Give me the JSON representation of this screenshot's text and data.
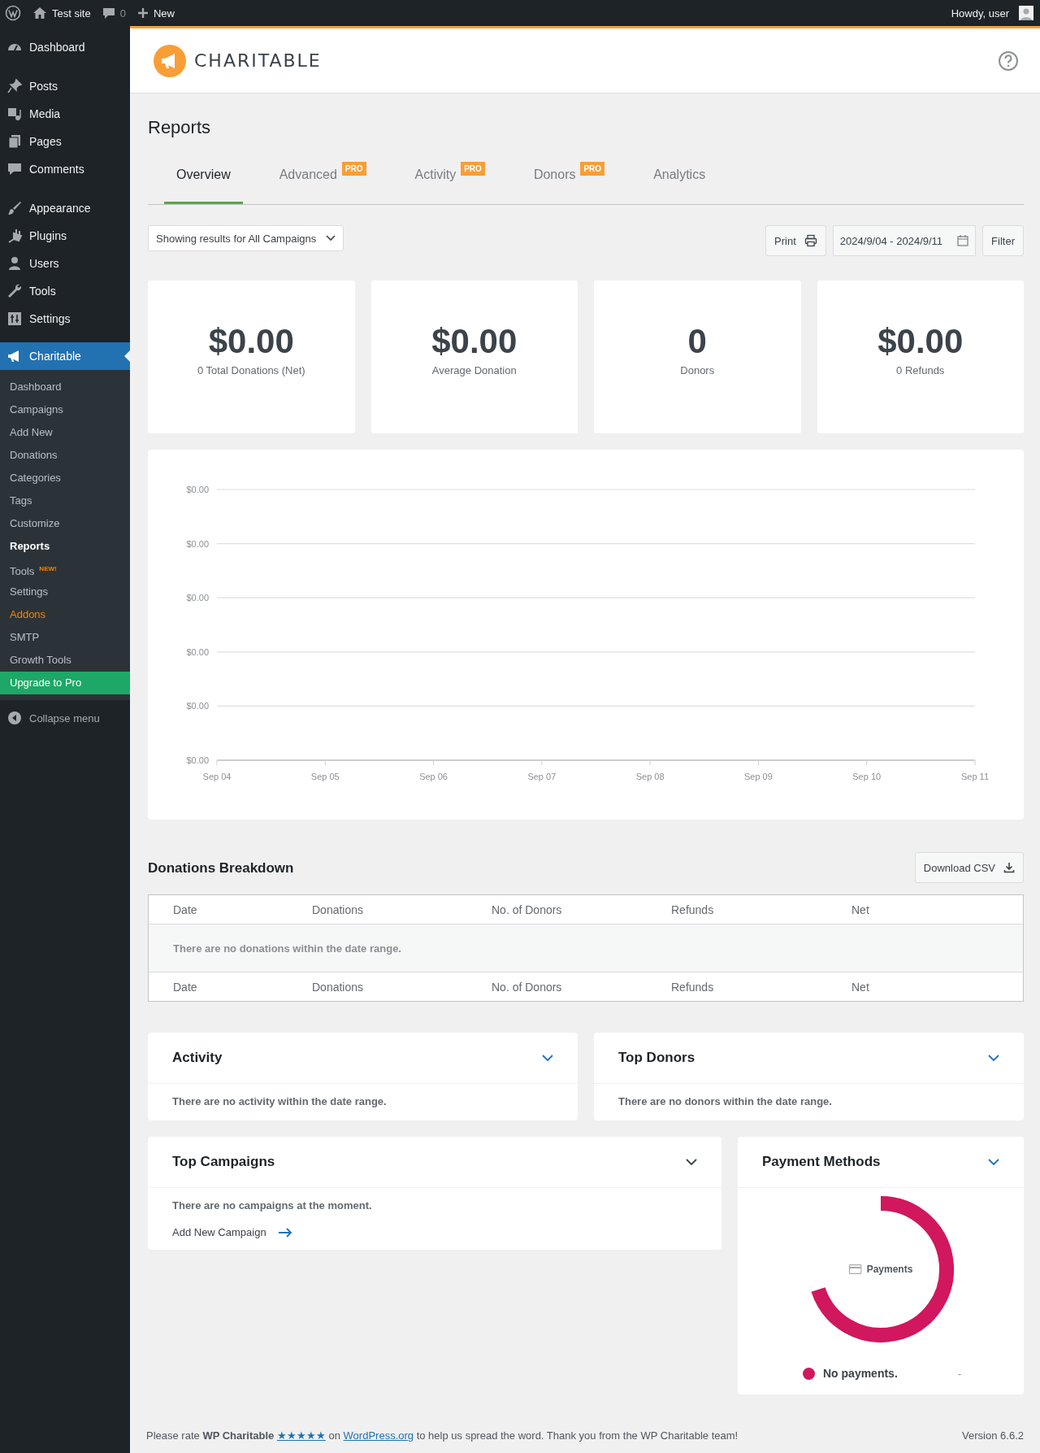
{
  "admin_bar": {
    "site": "Test site",
    "comments": "0",
    "new": "New",
    "greeting": "Howdy, user"
  },
  "sidebar": {
    "groups": [
      [
        {
          "label": "Dashboard"
        }
      ],
      [
        {
          "label": "Posts"
        },
        {
          "label": "Media"
        },
        {
          "label": "Pages"
        },
        {
          "label": "Comments"
        }
      ],
      [
        {
          "label": "Appearance"
        },
        {
          "label": "Plugins"
        },
        {
          "label": "Users"
        },
        {
          "label": "Tools"
        },
        {
          "label": "Settings"
        }
      ]
    ],
    "current": {
      "label": "Charitable",
      "selected": true
    },
    "submenu": [
      {
        "label": "Dashboard",
        "kind": "link",
        "selected": false
      },
      {
        "label": "Campaigns",
        "kind": "link",
        "selected": false
      },
      {
        "label": "Add New",
        "kind": "link",
        "selected": false
      },
      {
        "label": "Donations",
        "kind": "link",
        "selected": false
      },
      {
        "label": "Categories",
        "kind": "link",
        "selected": false
      },
      {
        "label": "Tags",
        "kind": "link",
        "selected": false
      },
      {
        "label": "Customize",
        "kind": "link",
        "selected": false
      },
      {
        "label": "Reports",
        "kind": "link",
        "selected": true
      },
      {
        "label": "Tools",
        "kind": "link",
        "selected": false,
        "badge": "NEW!"
      },
      {
        "label": "Settings",
        "kind": "link",
        "selected": false
      },
      {
        "label": "Addons",
        "kind": "addons",
        "selected": false
      },
      {
        "label": "SMTP",
        "kind": "link",
        "selected": false
      },
      {
        "label": "Growth Tools",
        "kind": "link",
        "selected": false
      },
      {
        "label": "Upgrade to Pro",
        "kind": "upgrade",
        "selected": false
      }
    ],
    "collapse": "Collapse menu"
  },
  "header": {
    "brand": "CHARITABLE"
  },
  "page_title": "Reports",
  "tabs": [
    {
      "label": "Overview",
      "selected": true
    },
    {
      "label": "Advanced",
      "selected": false,
      "badge": "PRO"
    },
    {
      "label": "Activity",
      "selected": false,
      "badge": "PRO"
    },
    {
      "label": "Donors",
      "selected": false,
      "badge": "PRO"
    },
    {
      "label": "Analytics",
      "selected": false
    }
  ],
  "controls": {
    "campaign_select": "Showing results for All Campaigns",
    "print": "Print",
    "date_range": "2024/9/04 - 2024/9/11",
    "filter": "Filter"
  },
  "stats": [
    {
      "value": "$0.00",
      "label": "0 Total Donations (Net)"
    },
    {
      "value": "$0.00",
      "label": "Average Donation"
    },
    {
      "value": "0",
      "label": "Donors"
    },
    {
      "value": "$0.00",
      "label": "0 Refunds"
    }
  ],
  "chart": {
    "x_labels": [
      "Sep 04",
      "Sep 05",
      "Sep 06",
      "Sep 07",
      "Sep 08",
      "Sep 09",
      "Sep 10",
      "Sep 11"
    ],
    "y_labels": [
      "$0.00",
      "$0.00",
      "$0.00",
      "$0.00",
      "$0.00",
      "$0.00"
    ]
  },
  "breakdown": {
    "title": "Donations Breakdown",
    "download": "Download CSV",
    "columns": [
      "Date",
      "Donations",
      "No. of Donors",
      "Refunds",
      "Net"
    ],
    "empty": "There are no donations within the date range.",
    "footer_columns": [
      "Date",
      "Donations",
      "No. of Donors",
      "Refunds",
      "Net"
    ]
  },
  "panels": [
    {
      "title": "Activity",
      "message": "There are no activity within the date range."
    },
    {
      "title": "Top Donors",
      "message": "There are no donors within the date range."
    }
  ],
  "top_campaigns": {
    "title": "Top Campaigns",
    "message": "There are no campaigns at the moment.",
    "link": "Add New Campaign"
  },
  "payment_methods": {
    "title": "Payment Methods",
    "center_label": "Payments",
    "legend": [
      {
        "label": "No payments.",
        "value": "-",
        "color": "#d1175e"
      }
    ]
  },
  "footer": {
    "rate_intro": "Please rate **WP Charitable**",
    "stars": "★★★★★",
    "on": "on",
    "site_link": "WordPress.org",
    "rest": "to help us spread the word. Thank you from the WP Charitable team!",
    "version": "Version 6.6.2"
  }
}
